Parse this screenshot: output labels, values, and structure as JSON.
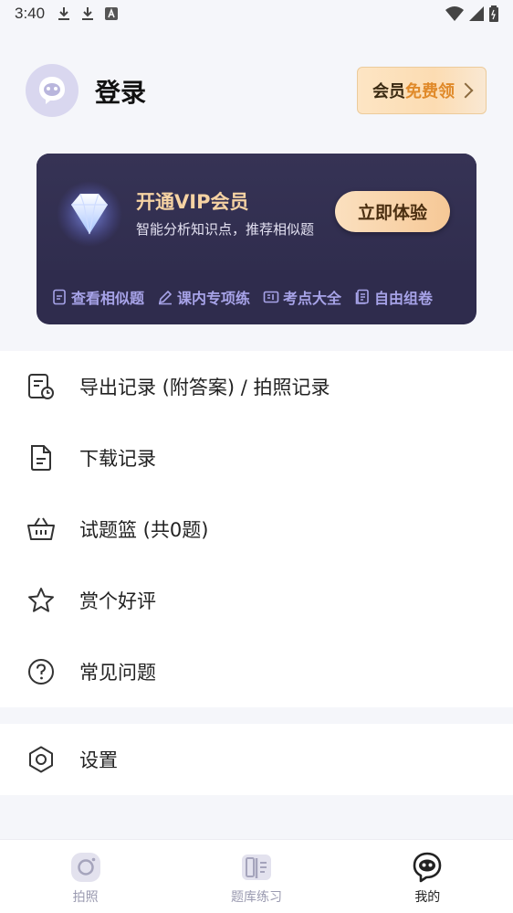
{
  "status_bar": {
    "time": "3:40",
    "icons": [
      "download-icon",
      "download-icon",
      "a-icon"
    ],
    "right_icons": [
      "wifi-icon",
      "signal-icon",
      "battery-icon"
    ]
  },
  "header": {
    "login": "登录",
    "member_prefix": "会员",
    "member_highlight": "免费领"
  },
  "vip": {
    "title": "开通VIP会员",
    "subtitle": "智能分析知识点，推荐相似题",
    "cta": "立即体验",
    "features": [
      {
        "label": "查看相似题",
        "icon": "doc-icon"
      },
      {
        "label": "课内专项练",
        "icon": "pencil-icon"
      },
      {
        "label": "考点大全",
        "icon": "ticket-icon"
      },
      {
        "label": "自由组卷",
        "icon": "paper-icon"
      }
    ]
  },
  "menu": [
    {
      "label": "导出记录 (附答案) / 拍照记录",
      "icon": "export-record-icon"
    },
    {
      "label": "下载记录",
      "icon": "file-icon"
    },
    {
      "label": "试题篮 (共0题)",
      "icon": "basket-icon"
    },
    {
      "label": "赏个好评",
      "icon": "star-icon"
    },
    {
      "label": "常见问题",
      "icon": "question-icon"
    }
  ],
  "settings": {
    "label": "设置",
    "icon": "hexagon-settings-icon"
  },
  "tabs": [
    {
      "label": "拍照",
      "icon": "camera-icon"
    },
    {
      "label": "题库练习",
      "icon": "book-icon"
    },
    {
      "label": "我的",
      "icon": "profile-icon"
    }
  ],
  "colors": {
    "accent_gold": "#f6d3a3",
    "vip_bg": "#2f2c4d",
    "feature_text": "#a7a3e8",
    "member_highlight": "#e08a2a"
  }
}
